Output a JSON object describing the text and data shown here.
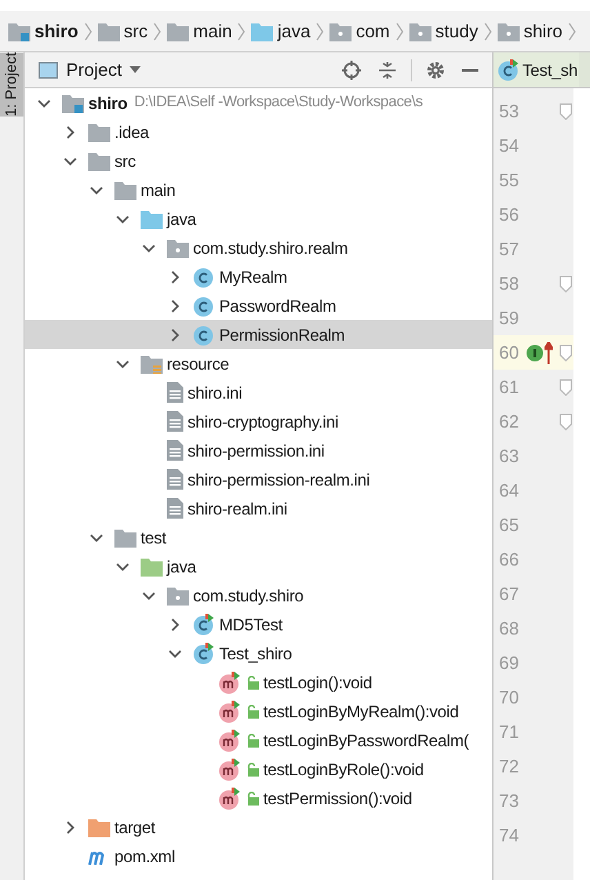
{
  "breadcrumbs": [
    {
      "label": "shiro",
      "kind": "module"
    },
    {
      "label": "src",
      "kind": "folder"
    },
    {
      "label": "main",
      "kind": "folder"
    },
    {
      "label": "java",
      "kind": "source"
    },
    {
      "label": "com",
      "kind": "package"
    },
    {
      "label": "study",
      "kind": "package"
    },
    {
      "label": "shiro",
      "kind": "package"
    }
  ],
  "side_tab": {
    "label": "1: Project",
    "selected": true
  },
  "project_panel": {
    "title": "Project",
    "tree": [
      {
        "label": "shiro",
        "path": "D:\\IDEA\\Self -Workspace\\Study-Workspace\\s",
        "kind": "module",
        "expanded": true,
        "selected": false,
        "children": [
          {
            "label": ".idea",
            "kind": "folder",
            "expanded": false,
            "selected": false
          },
          {
            "label": "src",
            "kind": "folder",
            "expanded": true,
            "selected": false,
            "children": [
              {
                "label": "main",
                "kind": "folder",
                "expanded": true,
                "selected": false,
                "children": [
                  {
                    "label": "java",
                    "kind": "source",
                    "expanded": true,
                    "selected": false,
                    "children": [
                      {
                        "label": "com.study.shiro.realm",
                        "kind": "package",
                        "expanded": true,
                        "selected": false,
                        "children": [
                          {
                            "label": "MyRealm",
                            "kind": "class",
                            "expanded": false,
                            "selected": false
                          },
                          {
                            "label": "PasswordRealm",
                            "kind": "class",
                            "expanded": false,
                            "selected": false
                          },
                          {
                            "label": "PermissionRealm",
                            "kind": "class",
                            "expanded": false,
                            "selected": true
                          }
                        ]
                      }
                    ]
                  },
                  {
                    "label": "resource",
                    "kind": "resource",
                    "expanded": true,
                    "selected": false,
                    "children": [
                      {
                        "label": "shiro.ini",
                        "kind": "file",
                        "selected": false
                      },
                      {
                        "label": "shiro-cryptography.ini",
                        "kind": "file",
                        "selected": false
                      },
                      {
                        "label": "shiro-permission.ini",
                        "kind": "file",
                        "selected": false
                      },
                      {
                        "label": "shiro-permission-realm.ini",
                        "kind": "file",
                        "selected": false
                      },
                      {
                        "label": "shiro-realm.ini",
                        "kind": "file",
                        "selected": false
                      }
                    ]
                  }
                ]
              },
              {
                "label": "test",
                "kind": "folder",
                "expanded": true,
                "selected": false,
                "children": [
                  {
                    "label": "java",
                    "kind": "test_source",
                    "expanded": true,
                    "selected": false,
                    "children": [
                      {
                        "label": "com.study.shiro",
                        "kind": "package",
                        "expanded": true,
                        "selected": false,
                        "children": [
                          {
                            "label": "MD5Test",
                            "kind": "test_class",
                            "expanded": false,
                            "selected": false
                          },
                          {
                            "label": "Test_shiro",
                            "kind": "test_class",
                            "expanded": true,
                            "selected": false,
                            "children": [
                              {
                                "label": "testLogin():void",
                                "kind": "method",
                                "selected": false
                              },
                              {
                                "label": "testLoginByMyRealm():void",
                                "kind": "method",
                                "selected": false
                              },
                              {
                                "label": "testLoginByPasswordRealm(",
                                "kind": "method",
                                "selected": false
                              },
                              {
                                "label": "testLoginByRole():void",
                                "kind": "method",
                                "selected": false
                              },
                              {
                                "label": "testPermission():void",
                                "kind": "method",
                                "selected": false
                              }
                            ]
                          }
                        ]
                      }
                    ]
                  }
                ]
              }
            ]
          },
          {
            "label": "target",
            "kind": "excluded",
            "expanded": false,
            "selected": false
          },
          {
            "label": "pom.xml",
            "kind": "maven",
            "selected": false
          }
        ]
      }
    ]
  },
  "editor": {
    "tab": {
      "label": "Test_sh",
      "selected": true
    },
    "lines": [
      {
        "number": "53",
        "fold": true,
        "current": false,
        "markers": false
      },
      {
        "number": "54",
        "fold": false,
        "current": false,
        "markers": false
      },
      {
        "number": "55",
        "fold": false,
        "current": false,
        "markers": false
      },
      {
        "number": "56",
        "fold": false,
        "current": false,
        "markers": false
      },
      {
        "number": "57",
        "fold": false,
        "current": false,
        "markers": false
      },
      {
        "number": "58",
        "fold": true,
        "current": false,
        "markers": false
      },
      {
        "number": "59",
        "fold": false,
        "current": false,
        "markers": false
      },
      {
        "number": "60",
        "fold": true,
        "current": true,
        "markers": true
      },
      {
        "number": "61",
        "fold": true,
        "current": false,
        "markers": false
      },
      {
        "number": "62",
        "fold": true,
        "current": false,
        "markers": false
      },
      {
        "number": "63",
        "fold": false,
        "current": false,
        "markers": false
      },
      {
        "number": "64",
        "fold": false,
        "current": false,
        "markers": false
      },
      {
        "number": "65",
        "fold": false,
        "current": false,
        "markers": false
      },
      {
        "number": "66",
        "fold": false,
        "current": false,
        "markers": false
      },
      {
        "number": "67",
        "fold": false,
        "current": false,
        "markers": false
      },
      {
        "number": "68",
        "fold": false,
        "current": false,
        "markers": false
      },
      {
        "number": "69",
        "fold": false,
        "current": false,
        "markers": false
      },
      {
        "number": "70",
        "fold": false,
        "current": false,
        "markers": false
      },
      {
        "number": "71",
        "fold": false,
        "current": false,
        "markers": false
      },
      {
        "number": "72",
        "fold": false,
        "current": false,
        "markers": false
      },
      {
        "number": "73",
        "fold": false,
        "current": false,
        "markers": false
      },
      {
        "number": "74",
        "fold": false,
        "current": false,
        "markers": false
      }
    ]
  }
}
